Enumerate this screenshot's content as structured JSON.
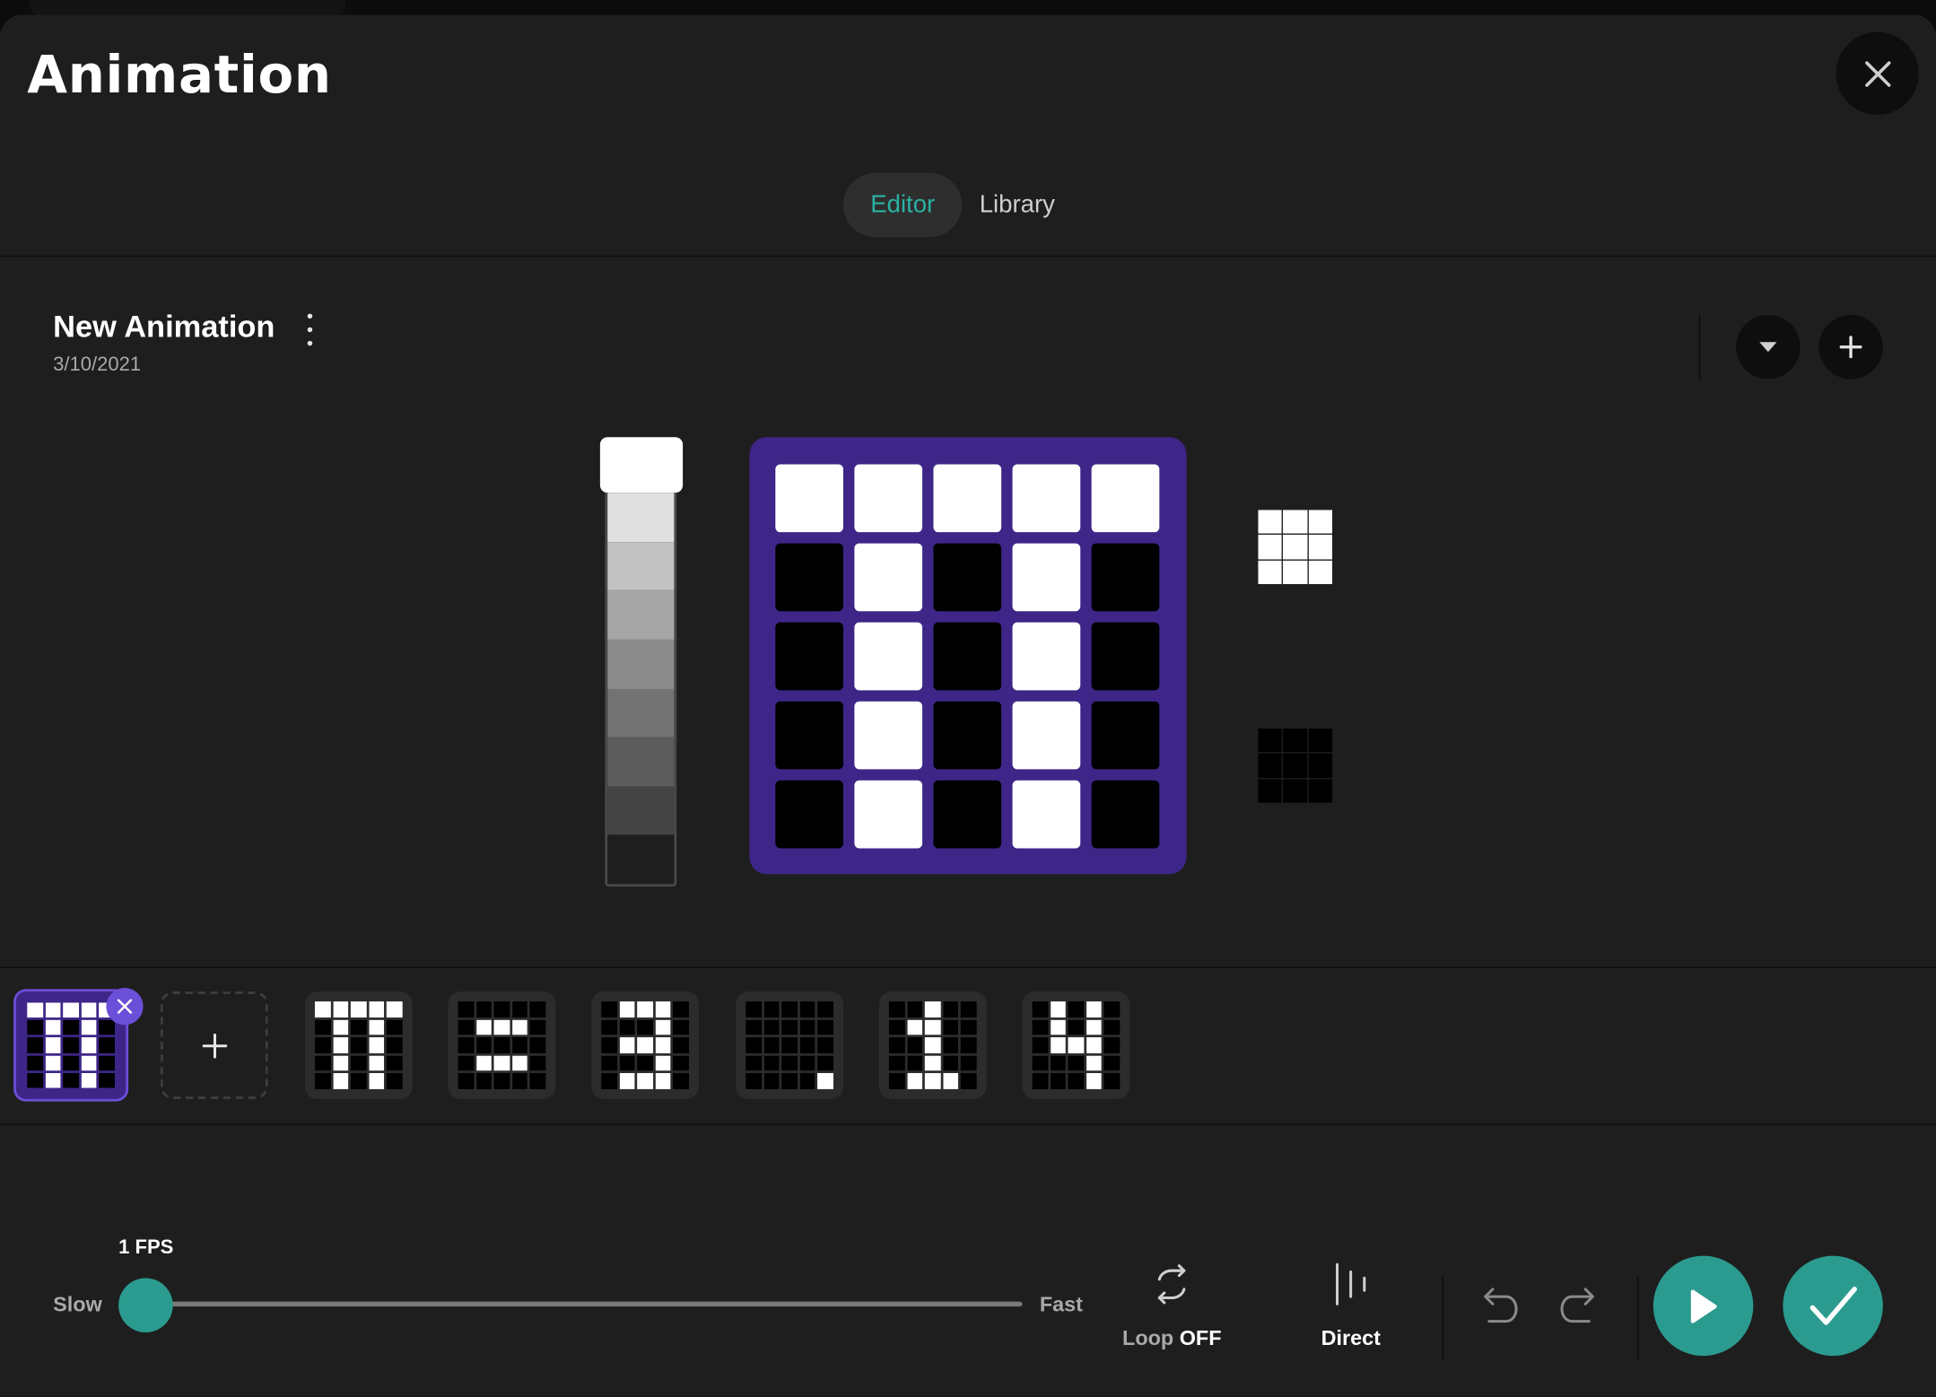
{
  "window": {
    "title": "Animation"
  },
  "tabs": [
    {
      "label": "Editor",
      "active": true
    },
    {
      "label": "Library",
      "active": false
    }
  ],
  "animation": {
    "name": "New Animation",
    "date": "3/10/2021"
  },
  "brightness_levels": [
    "#e0e0e0",
    "#c2c2c2",
    "#a6a6a6",
    "#8c8c8c",
    "#737373",
    "#5c5c5c",
    "#444444",
    "#1e1e1e"
  ],
  "matrix": [
    [
      1,
      1,
      1,
      1,
      1
    ],
    [
      0,
      1,
      0,
      1,
      0
    ],
    [
      0,
      1,
      0,
      1,
      0
    ],
    [
      0,
      1,
      0,
      1,
      0
    ],
    [
      0,
      1,
      0,
      1,
      0
    ]
  ],
  "presets": [
    {
      "name": "all-on",
      "color": "#ffffff"
    },
    {
      "name": "all-off",
      "color": "#000000"
    }
  ],
  "frames": [
    {
      "selected": true,
      "pixels": [
        [
          1,
          1,
          1,
          1,
          1
        ],
        [
          0,
          1,
          0,
          1,
          0
        ],
        [
          0,
          1,
          0,
          1,
          0
        ],
        [
          0,
          1,
          0,
          1,
          0
        ],
        [
          0,
          1,
          0,
          1,
          0
        ]
      ]
    },
    {
      "selected": false,
      "pixels": [
        [
          1,
          1,
          1,
          1,
          1
        ],
        [
          0,
          1,
          0,
          1,
          0
        ],
        [
          0,
          1,
          0,
          1,
          0
        ],
        [
          0,
          1,
          0,
          1,
          0
        ],
        [
          0,
          1,
          0,
          1,
          0
        ]
      ]
    },
    {
      "selected": false,
      "pixels": [
        [
          0,
          0,
          0,
          0,
          0
        ],
        [
          0,
          1,
          1,
          1,
          0
        ],
        [
          0,
          0,
          0,
          0,
          0
        ],
        [
          0,
          1,
          1,
          1,
          0
        ],
        [
          0,
          0,
          0,
          0,
          0
        ]
      ]
    },
    {
      "selected": false,
      "pixels": [
        [
          0,
          1,
          1,
          1,
          0
        ],
        [
          0,
          0,
          0,
          1,
          0
        ],
        [
          0,
          1,
          1,
          1,
          0
        ],
        [
          0,
          0,
          0,
          1,
          0
        ],
        [
          0,
          1,
          1,
          1,
          0
        ]
      ]
    },
    {
      "selected": false,
      "pixels": [
        [
          0,
          0,
          0,
          0,
          0
        ],
        [
          0,
          0,
          0,
          0,
          0
        ],
        [
          0,
          0,
          0,
          0,
          0
        ],
        [
          0,
          0,
          0,
          0,
          0
        ],
        [
          0,
          0,
          0,
          0,
          1
        ]
      ]
    },
    {
      "selected": false,
      "pixels": [
        [
          0,
          0,
          1,
          0,
          0
        ],
        [
          0,
          1,
          1,
          0,
          0
        ],
        [
          0,
          0,
          1,
          0,
          0
        ],
        [
          0,
          0,
          1,
          0,
          0
        ],
        [
          0,
          1,
          1,
          1,
          0
        ]
      ]
    },
    {
      "selected": false,
      "pixels": [
        [
          0,
          1,
          0,
          1,
          0
        ],
        [
          0,
          1,
          0,
          1,
          0
        ],
        [
          0,
          1,
          1,
          1,
          0
        ],
        [
          0,
          0,
          0,
          1,
          0
        ],
        [
          0,
          0,
          0,
          1,
          0
        ]
      ]
    }
  ],
  "playback": {
    "fps_label": "1 FPS",
    "fps": 1,
    "slow_label": "Slow",
    "fast_label": "Fast",
    "loop_label": "Loop",
    "loop_state": "OFF",
    "direction_label": "Direct"
  },
  "colors": {
    "accent": "#2b9b8f",
    "tab_accent": "#2bb1a3",
    "matrix_bg": "#3d2688",
    "selected_frame": "#6b4fd8"
  },
  "icons": [
    "close-icon",
    "more-vertical-icon",
    "chevron-down-icon",
    "plus-icon",
    "loop-icon",
    "direction-icon",
    "undo-icon",
    "redo-icon",
    "play-icon",
    "check-icon"
  ]
}
